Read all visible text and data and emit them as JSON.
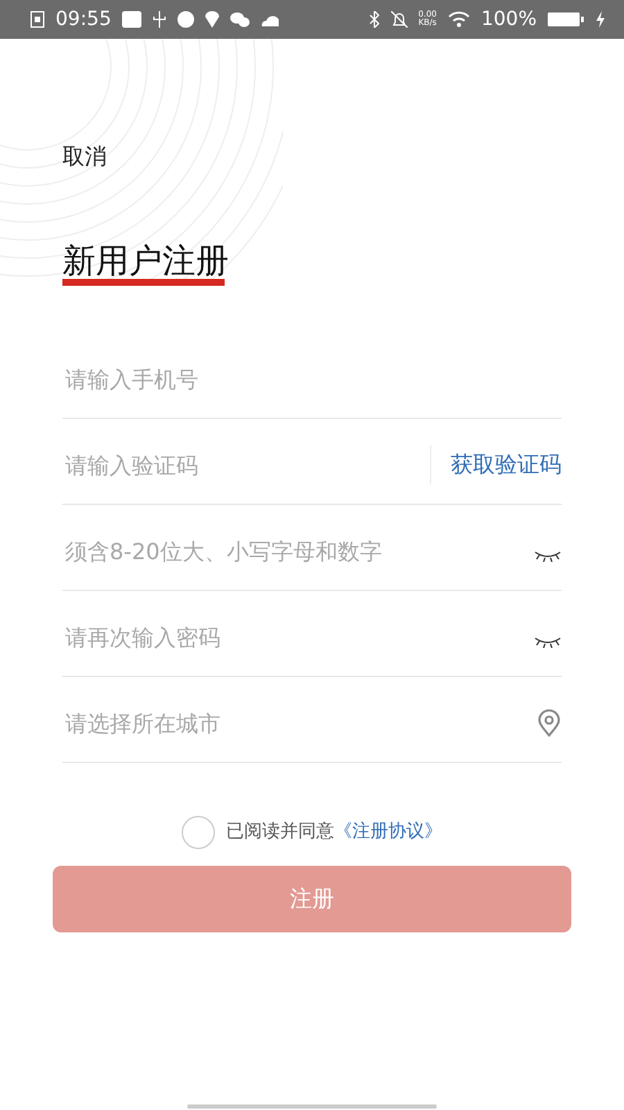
{
  "status_bar": {
    "time": "09:55",
    "net_speed": "0.00",
    "net_unit": "KB/s",
    "battery": "100%"
  },
  "cancel": "取消",
  "title": "新用户注册",
  "fields": [
    {
      "kind": "plain",
      "placeholder": "请输入手机号"
    },
    {
      "kind": "code",
      "placeholder": "请输入验证码",
      "action": "获取验证码"
    },
    {
      "kind": "password",
      "placeholder": "须含8-20位大、小写字母和数字"
    },
    {
      "kind": "password",
      "placeholder": "请再次输入密码"
    },
    {
      "kind": "location",
      "placeholder": "请选择所在城市"
    }
  ],
  "agreement": {
    "checked": false,
    "text": "已阅读并同意",
    "link": "《注册协议》"
  },
  "submit": {
    "label": "注册",
    "disabled": true
  }
}
